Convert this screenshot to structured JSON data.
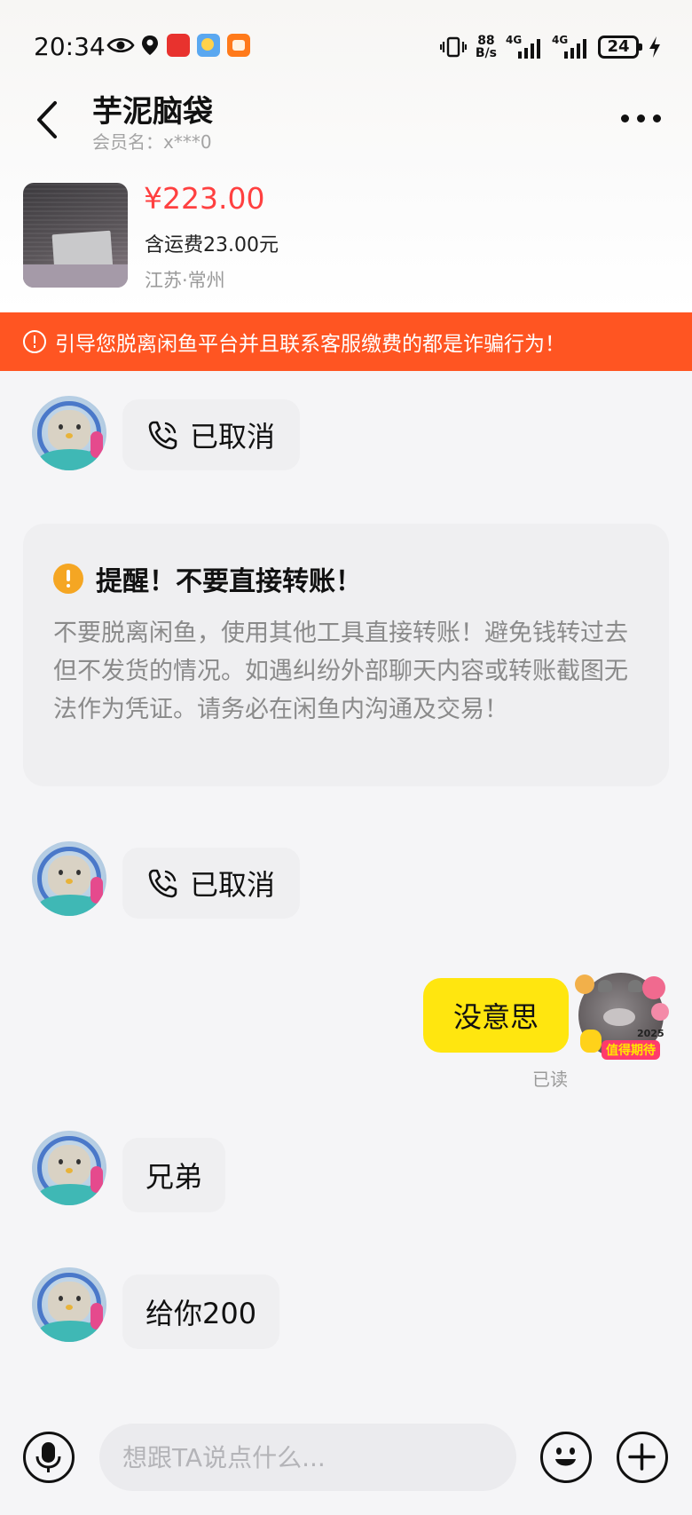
{
  "status_bar": {
    "time": "20:34",
    "net_speed_top": "88",
    "net_speed_bottom": "B/s",
    "signal_1": "4G",
    "signal_2": "4G",
    "battery": "24"
  },
  "header": {
    "title": "芋泥脑袋",
    "member_name": "会员名：x***0"
  },
  "product": {
    "price": "¥223.00",
    "shipping": "含运费23.00元",
    "location": "江苏·常州"
  },
  "warning_banner": "引导您脱离闲鱼平台并且联系客服缴费的都是诈骗行为！",
  "messages": {
    "call_1": "已取消",
    "notice_title": "提醒！不要直接转账！",
    "notice_body": "不要脱离闲鱼，使用其他工具直接转账！避免钱转过去但不发货的情况。如遇纠纷外部聊天内容或转账截图无法作为凭证。请务必在闲鱼内沟通及交易！",
    "call_2": "已取消",
    "outgoing_1": "没意思",
    "read_status": "已读",
    "incoming_1": "兄弟",
    "incoming_2": "给你200",
    "my_avatar_badge": "值得期待",
    "my_avatar_year": "2025"
  },
  "input_bar": {
    "placeholder": "想跟TA说点什么..."
  },
  "colors": {
    "price": "#ff4040",
    "warning_banner": "#ff5522",
    "outgoing_bubble": "#ffe60f",
    "incoming_bubble": "#efeff1",
    "notice_icon": "#f5a623"
  },
  "icons": [
    "back-arrow-icon",
    "more-icon",
    "alert-circle-icon",
    "phone-call-icon",
    "exclamation-icon",
    "microphone-icon",
    "emoji-icon",
    "plus-icon",
    "eye-icon",
    "location-icon",
    "vibrate-icon",
    "charging-icon"
  ]
}
